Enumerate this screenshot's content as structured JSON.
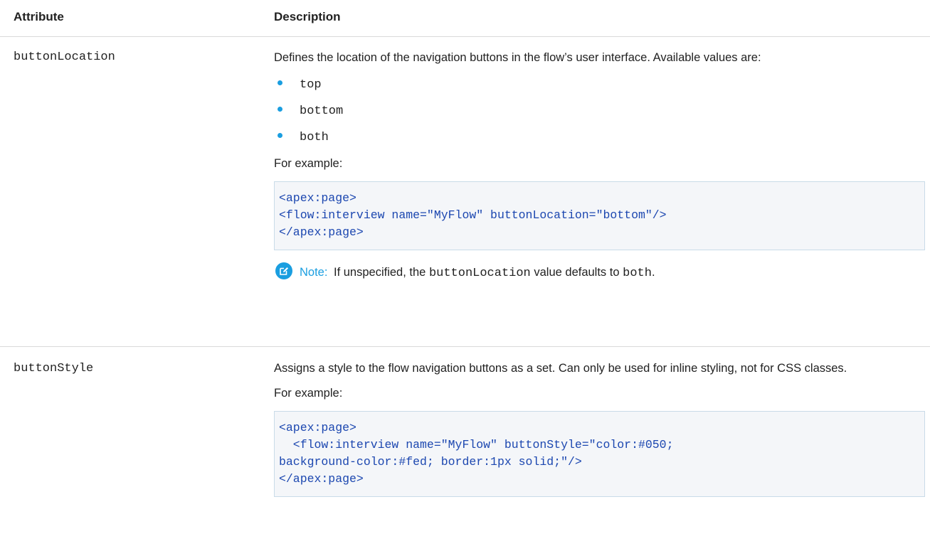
{
  "table": {
    "headers": {
      "attribute": "Attribute",
      "description": "Description"
    },
    "rows": [
      {
        "attribute": "buttonLocation",
        "description": "Defines the location of the navigation buttons in the flow’s user interface. Available values are:",
        "values": [
          "top",
          "bottom",
          "both"
        ],
        "example_intro": "For example:",
        "code": "<apex:page>\n<flow:interview name=\"MyFlow\" buttonLocation=\"bottom\"/>\n</apex:page>",
        "note": {
          "label": "Note:",
          "text_before": "If unspecified, the",
          "code_term": "buttonLocation",
          "text_middle": "value defaults to",
          "code_value": "both",
          "text_end": "."
        }
      },
      {
        "attribute": "buttonStyle",
        "description": "Assigns a style to the flow navigation buttons as a set. Can only be used for inline styling, not for CSS classes.",
        "example_intro": "For example:",
        "code": "<apex:page>\n  <flow:interview name=\"MyFlow\" buttonStyle=\"color:#050;\nbackground-color:#fed; border:1px solid;\"/>\n</apex:page>"
      }
    ]
  },
  "icons": {
    "note": "edit-note-icon",
    "bullet": "bullet-dot"
  },
  "colors": {
    "accent": "#1a9ee0",
    "code_text": "#1c47b0",
    "code_bg": "#f4f6f9",
    "code_border": "#c9dbe8",
    "rule": "#d9d9d9"
  }
}
